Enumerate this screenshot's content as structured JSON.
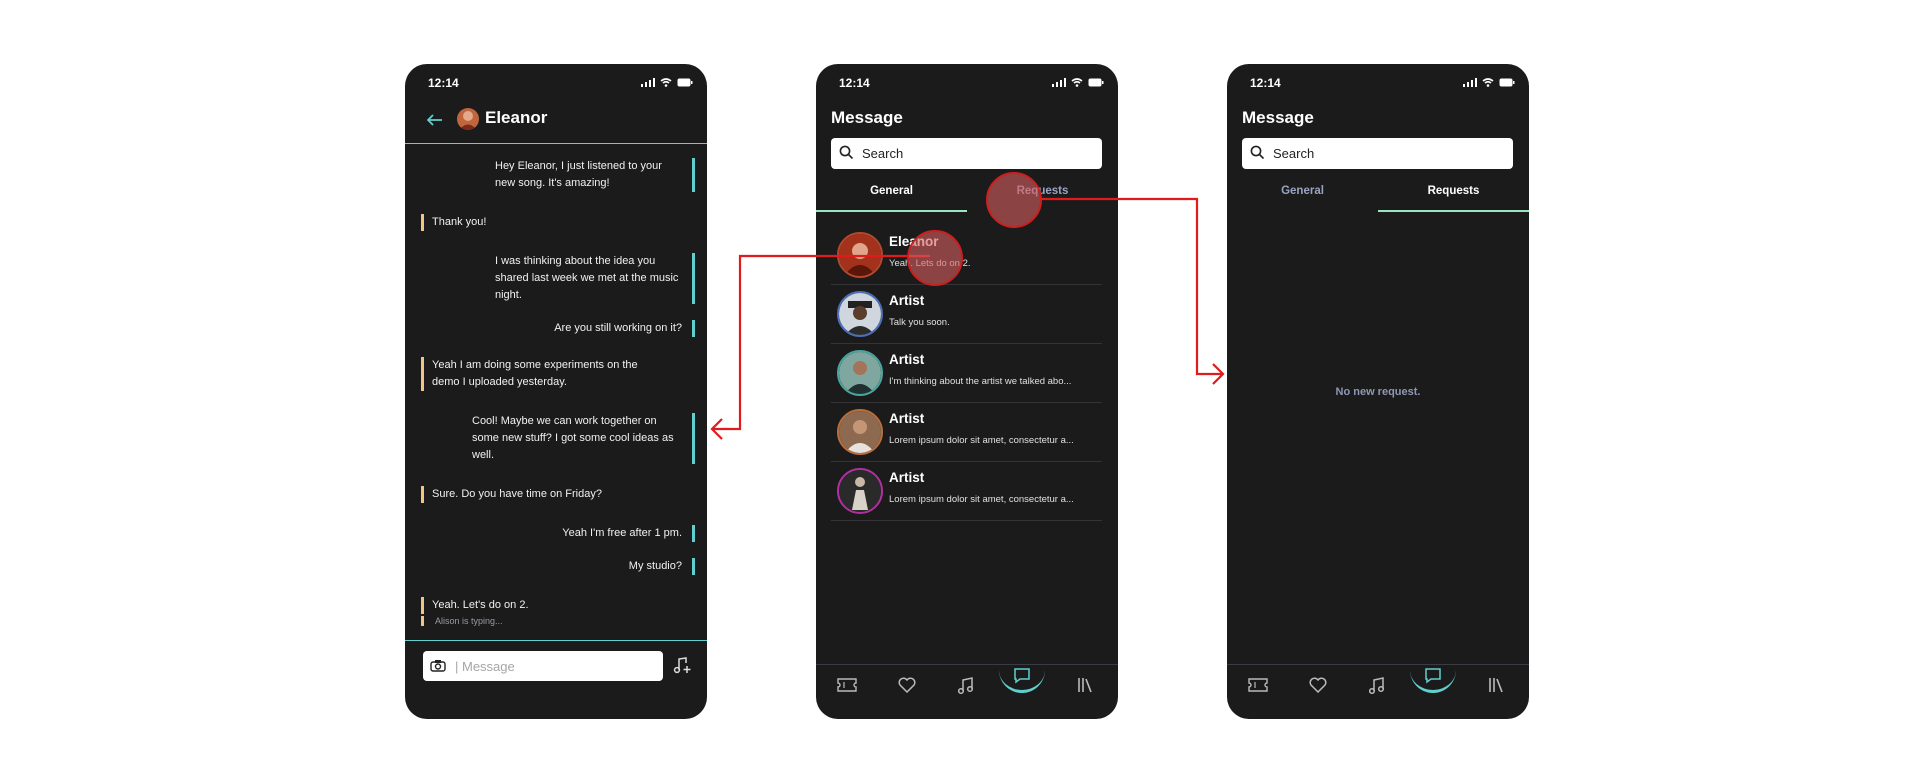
{
  "status_time": "12:14",
  "chat": {
    "contact_name": "Eleanor",
    "messages": [
      {
        "dir": "out",
        "text": "Hey Eleanor, I just listened to your new song. It's amazing!"
      },
      {
        "dir": "in",
        "text": "Thank you!"
      },
      {
        "dir": "out",
        "text": "I was thinking about the idea you shared last week we met at the music night."
      },
      {
        "dir": "out",
        "text": "Are you still working on it?"
      },
      {
        "dir": "in",
        "text": "Yeah I am doing some experiments on the demo I uploaded yesterday."
      },
      {
        "dir": "out",
        "text": "Cool! Maybe we can work together on some new stuff? I got some cool ideas as well."
      },
      {
        "dir": "in",
        "text": "Sure. Do you have time on Friday?"
      },
      {
        "dir": "out",
        "text": "Yeah I'm free after 1 pm."
      },
      {
        "dir": "out",
        "text": "My studio?"
      },
      {
        "dir": "in",
        "text": "Yeah. Let's do on 2."
      }
    ],
    "typing_text": "Alison is typing...",
    "input_placeholder": "| Message"
  },
  "messages_screen": {
    "title": "Message",
    "search_placeholder": "Search",
    "tabs": [
      "General",
      "Requests"
    ],
    "conversations": [
      {
        "name": "Eleanor",
        "preview": "Yeah. Lets do on 2."
      },
      {
        "name": "Artist",
        "preview": "Talk you soon."
      },
      {
        "name": "Artist",
        "preview": "I'm thinking about the artist we talked abo..."
      },
      {
        "name": "Artist",
        "preview": "Lorem ipsum dolor sit amet, consectetur a..."
      },
      {
        "name": "Artist",
        "preview": "Lorem ipsum dolor sit amet, consectetur a..."
      }
    ]
  },
  "requests_screen": {
    "title": "Message",
    "search_placeholder": "Search",
    "tabs": [
      "General",
      "Requests"
    ],
    "empty_text": "No new request."
  },
  "nav_icons": [
    "ticket-icon",
    "heart-icon",
    "music-note-icon",
    "chat-icon",
    "library-icon"
  ],
  "colors": {
    "accent": "#5fd0cf",
    "incoming": "#f1c58a",
    "background": "#1b1b1c",
    "annotation": "#e01b1b"
  }
}
